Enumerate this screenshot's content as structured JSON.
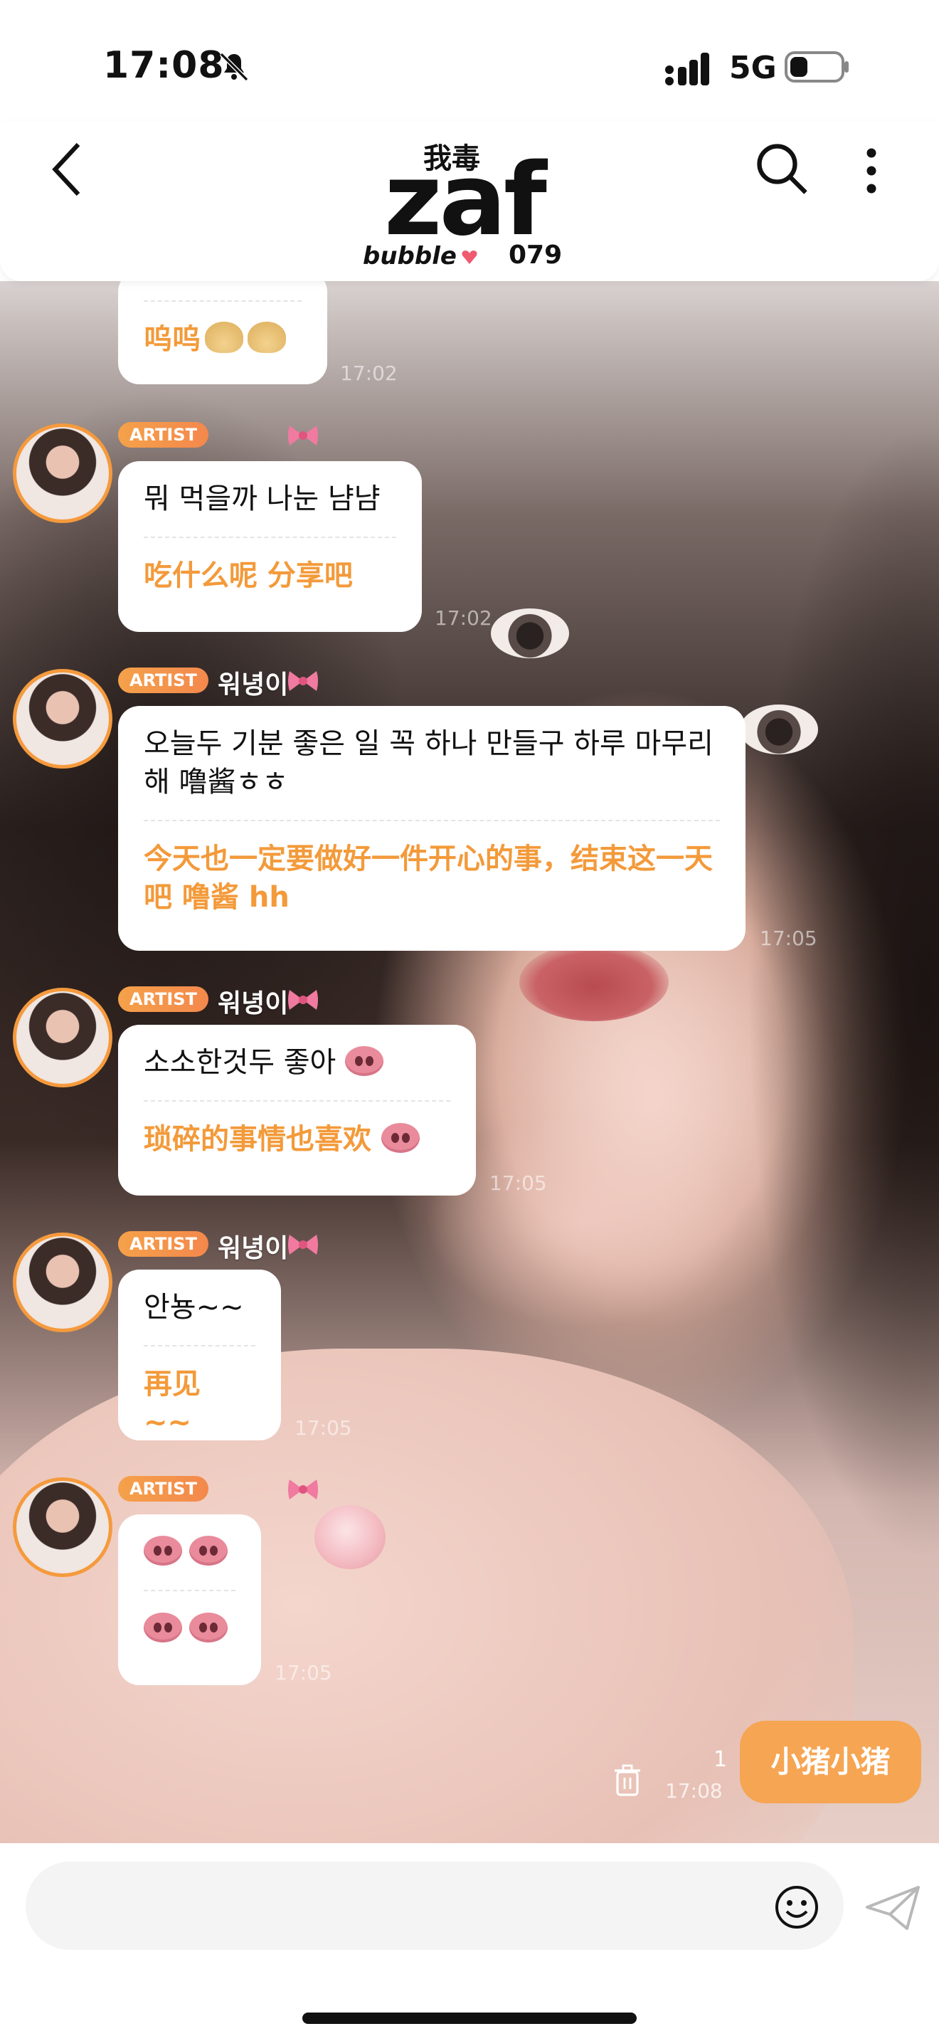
{
  "status_bar": {
    "time": "17:08",
    "network": "5G"
  },
  "header": {
    "logo_cn": "我毒",
    "logo_main": "zaf",
    "logo_sub": "bubble",
    "logo_num": "079"
  },
  "messages": [
    {
      "kr": "",
      "cn": "呜呜",
      "time": "17:02",
      "tag": "",
      "name": ""
    },
    {
      "tag": "ARTIST",
      "name": "",
      "kr": "뭐 먹을까 나눈 냠냠",
      "cn": "吃什么呢 分享吧",
      "time": "17:02"
    },
    {
      "tag": "ARTIST",
      "name": "워녕이",
      "kr": "오늘두 기분 좋은 일 꼭 하나 만들구 하루 마무리 해 噜酱ㅎㅎ",
      "cn": "今天也一定要做好一件开心的事，结束这一天吧 噜酱 hh",
      "time": "17:05"
    },
    {
      "tag": "ARTIST",
      "name": "워녕이",
      "kr": "소소한것두 좋아",
      "cn": "琐碎的事情也喜欢",
      "time": "17:05"
    },
    {
      "tag": "ARTIST",
      "name": "워녕이",
      "kr": "안뇽~~",
      "cn": "再见 ~~",
      "time": "17:05"
    },
    {
      "tag": "ARTIST",
      "name": "",
      "kr": "",
      "cn": "",
      "time": "17:05"
    }
  ],
  "own_message": {
    "text": "小猪小猪",
    "read_count": "1",
    "time": "17:08"
  },
  "input": {
    "placeholder": ""
  },
  "icons": [
    "bell-slash-icon",
    "signal-icon",
    "battery-icon",
    "back-icon",
    "search-icon",
    "more-icon",
    "bow-icon",
    "pig-emoji-icon",
    "dumpling-emoji-icon",
    "trash-icon",
    "smile-icon",
    "send-icon"
  ],
  "colors": {
    "accent": "#f39a3a",
    "own_bubble": "#f6a553",
    "artist_tag": "#f4884c"
  }
}
